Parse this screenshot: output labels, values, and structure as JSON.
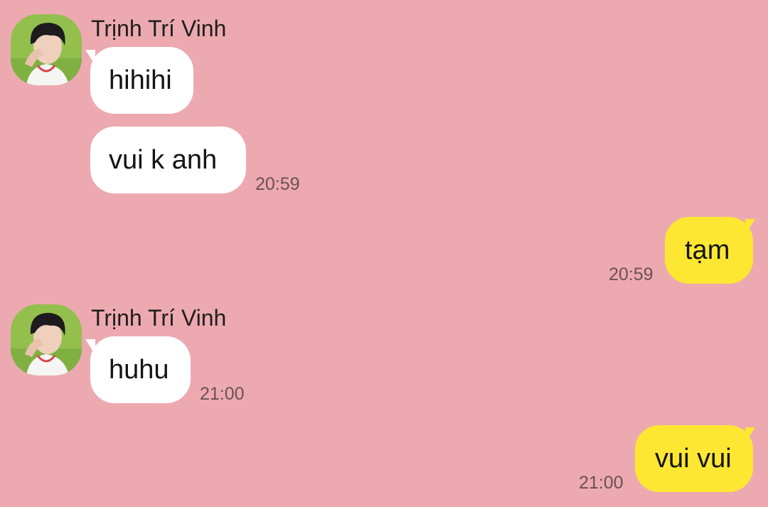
{
  "colors": {
    "background": "#eda9b0",
    "incoming_bubble": "#ffffff",
    "outgoing_bubble": "#fee733",
    "timestamp": "#6b5155"
  },
  "messages": [
    {
      "direction": "incoming",
      "sender": "Trịnh Trí Vinh",
      "text": "hihihi",
      "time": ""
    },
    {
      "direction": "incoming",
      "sender": "",
      "text": "vui k anh",
      "time": "20:59"
    },
    {
      "direction": "outgoing",
      "sender": "",
      "text": "tạm",
      "time": "20:59"
    },
    {
      "direction": "incoming",
      "sender": "Trịnh Trí Vinh",
      "text": "huhu",
      "time": "21:00"
    },
    {
      "direction": "outgoing",
      "sender": "",
      "text": "vui vui",
      "time": "21:00"
    }
  ]
}
